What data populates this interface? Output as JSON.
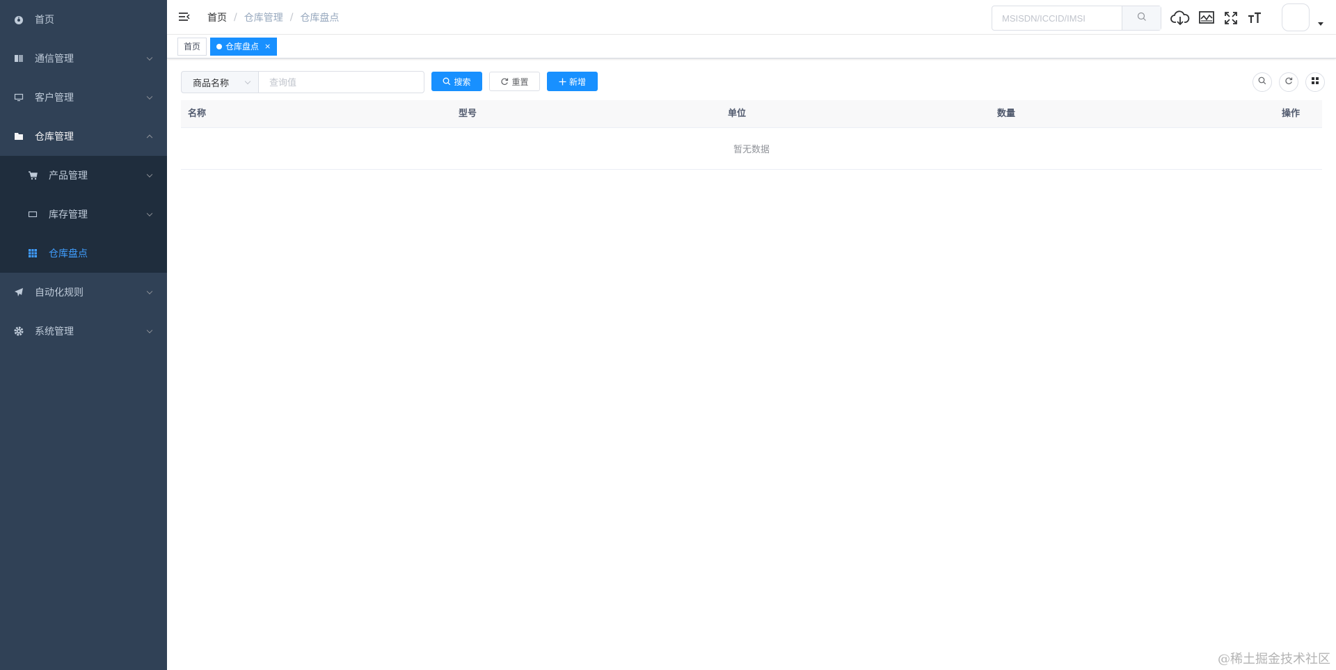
{
  "sidebar": {
    "items": [
      {
        "label": "首页",
        "icon": "dashboard-icon"
      },
      {
        "label": "通信管理",
        "icon": "book-icon"
      },
      {
        "label": "客户管理",
        "icon": "monitor-icon"
      },
      {
        "label": "仓库管理",
        "icon": "folder-icon"
      },
      {
        "label": "自动化规则",
        "icon": "send-icon"
      },
      {
        "label": "系统管理",
        "icon": "gear-icon"
      }
    ],
    "sub_items": [
      {
        "label": "产品管理",
        "icon": "cart-icon"
      },
      {
        "label": "库存管理",
        "icon": "rectangle-icon"
      },
      {
        "label": "仓库盘点",
        "icon": "grid-table-icon"
      }
    ],
    "active_color": "#409eff",
    "bg_color": "#304156"
  },
  "breadcrumb": [
    "首页",
    "仓库管理",
    "仓库盘点"
  ],
  "breadcrumb_sep": "/",
  "top_search": {
    "placeholder": "MSISDN/ICCID/IMSI"
  },
  "tags": [
    {
      "label": "首页"
    },
    {
      "label": "仓库盘点",
      "close": "×"
    }
  ],
  "query": {
    "select_value": "商品名称",
    "input_placeholder": "查询值",
    "search_label": "搜索",
    "reset_label": "重置",
    "add_label": "新增"
  },
  "table": {
    "columns": [
      "名称",
      "型号",
      "单位",
      "数量",
      "操作"
    ],
    "empty_text": "暂无数据"
  },
  "watermark": "@稀土掘金技术社区",
  "primary_color": "#1890ff"
}
